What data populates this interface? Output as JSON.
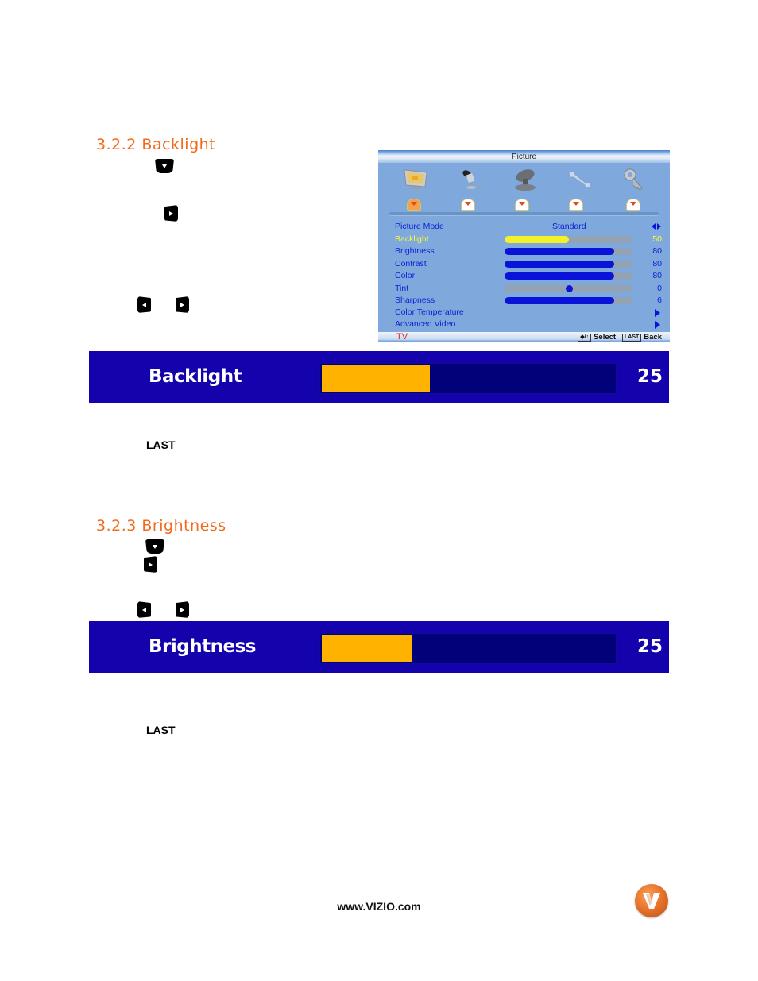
{
  "sections": [
    {
      "heading": "3.2.2 Backlight",
      "banner": {
        "label": "Backlight",
        "value": "25",
        "fill_fraction": 0.37
      },
      "last_key_label": "LAST"
    },
    {
      "heading": "3.2.3 Brightness",
      "banner": {
        "label": "Brightness",
        "value": "25",
        "fill_fraction": 0.31
      },
      "last_key_label": "LAST"
    }
  ],
  "remote_keys": {
    "down": "down-arrow-key",
    "right": "right-arrow-key",
    "left": "left-arrow-key"
  },
  "osd": {
    "title": "Picture",
    "tabs": [
      "picture",
      "audio",
      "tv-antenna",
      "setup",
      "parental-lock"
    ],
    "active_tab": 0,
    "rows": [
      {
        "label": "Picture Mode",
        "value_text": "Standard",
        "control": "left-right"
      },
      {
        "label": "Backlight",
        "value": "50",
        "fill": 0.5,
        "selected": true
      },
      {
        "label": "Brightness",
        "value": "80",
        "fill": 0.86
      },
      {
        "label": "Contrast",
        "value": "80",
        "fill": 0.86
      },
      {
        "label": "Color",
        "value": "80",
        "fill": 0.86
      },
      {
        "label": "Tint",
        "value": "0",
        "dot": 0.5
      },
      {
        "label": "Sharpness",
        "value": "6",
        "fill": 0.86
      },
      {
        "label": "Color Temperature",
        "control": "submenu"
      },
      {
        "label": "Advanced Video",
        "control": "submenu"
      }
    ],
    "footer": {
      "source": "TV",
      "nav_key": "◆/↕",
      "select": "Select",
      "last_key": "LAST",
      "back": "Back"
    }
  },
  "footer": {
    "url": "www.VIZIO.com",
    "logo": "vizio-v-logo"
  }
}
